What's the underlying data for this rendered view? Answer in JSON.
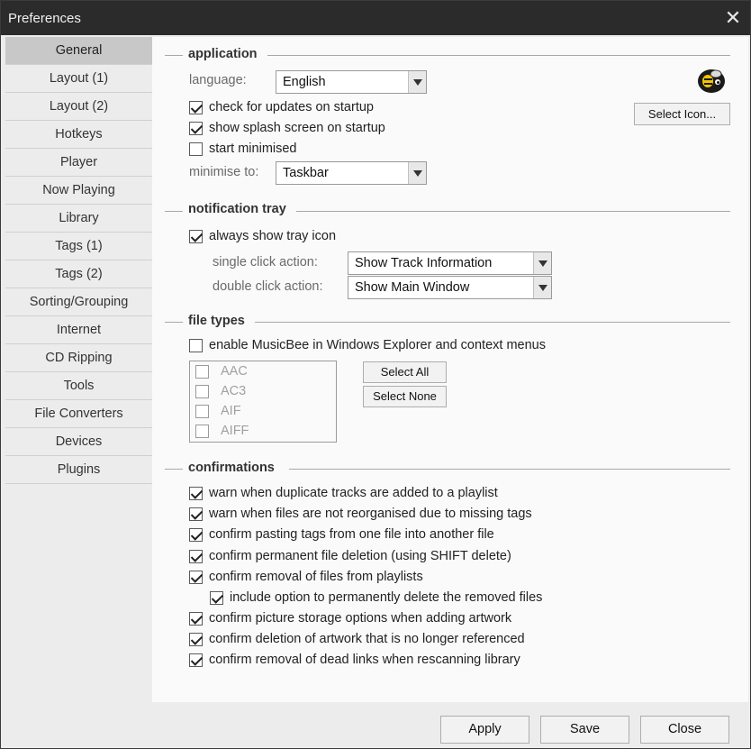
{
  "window": {
    "title": "Preferences",
    "close_glyph": "✕"
  },
  "sidebar": {
    "items": [
      {
        "label": "General",
        "active": true
      },
      {
        "label": "Layout (1)"
      },
      {
        "label": "Layout (2)"
      },
      {
        "label": "Hotkeys"
      },
      {
        "label": "Player"
      },
      {
        "label": "Now Playing"
      },
      {
        "label": "Library"
      },
      {
        "label": "Tags (1)"
      },
      {
        "label": "Tags (2)"
      },
      {
        "label": "Sorting/Grouping"
      },
      {
        "label": "Internet"
      },
      {
        "label": "CD Ripping"
      },
      {
        "label": "Tools"
      },
      {
        "label": "File Converters"
      },
      {
        "label": "Devices"
      },
      {
        "label": "Plugins"
      }
    ]
  },
  "application": {
    "title": "application",
    "language_label": "language:",
    "language_value": "English",
    "check_updates": {
      "label": "check for updates on startup",
      "checked": true
    },
    "splash": {
      "label": "show splash screen on startup",
      "checked": true
    },
    "start_min": {
      "label": "start minimised",
      "checked": false
    },
    "minimise_label": "minimise to:",
    "minimise_value": "Taskbar",
    "select_icon_label": "Select Icon..."
  },
  "tray": {
    "title": "notification tray",
    "always_show": {
      "label": "always show tray icon",
      "checked": true
    },
    "single_label": "single click action:",
    "single_value": "Show Track Information",
    "double_label": "double click action:",
    "double_value": "Show Main Window"
  },
  "file_types": {
    "title": "file types",
    "enable": {
      "label": "enable MusicBee in Windows Explorer and context menus",
      "checked": false
    },
    "list": [
      "AAC",
      "AC3",
      "AIF",
      "AIFF"
    ],
    "select_all": "Select All",
    "select_none": "Select None"
  },
  "confirmations": {
    "title": "confirmations",
    "items": [
      {
        "label": "warn when duplicate tracks are added to a playlist",
        "checked": true
      },
      {
        "label": "warn when files are not reorganised due to missing tags",
        "checked": true
      },
      {
        "label": "confirm pasting tags from one file into another file",
        "checked": true
      },
      {
        "label": "confirm permanent file deletion (using SHIFT delete)",
        "checked": true
      },
      {
        "label": "confirm removal of files from playlists",
        "checked": true
      },
      {
        "label": "include option to permanently delete the removed files",
        "checked": true
      },
      {
        "label": "confirm picture storage options when adding artwork",
        "checked": true
      },
      {
        "label": "confirm deletion of artwork that is no longer referenced",
        "checked": true
      },
      {
        "label": "confirm removal of dead links when rescanning library",
        "checked": true
      }
    ]
  },
  "footer": {
    "apply": "Apply",
    "save": "Save",
    "close": "Close"
  }
}
